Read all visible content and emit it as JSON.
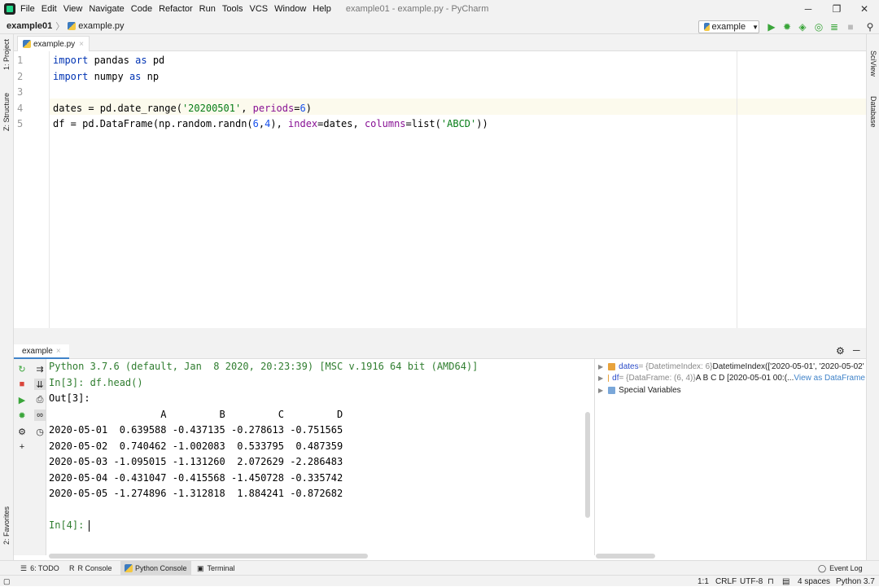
{
  "menubar": {
    "items": [
      "File",
      "Edit",
      "View",
      "Navigate",
      "Code",
      "Refactor",
      "Run",
      "Tools",
      "VCS",
      "Window",
      "Help"
    ],
    "title": "example01 - example.py - PyCharm"
  },
  "window": {
    "minimize": "─",
    "maximize": "❐",
    "close": "✕"
  },
  "navbar": {
    "project": "example01",
    "file": "example.py",
    "separator": "〉"
  },
  "run_config": {
    "name": "example"
  },
  "left_stripe": {
    "project": "1: Project",
    "structure": "Z: Structure",
    "favorites": "2: Favorites"
  },
  "right_stripe": {
    "sciview": "SciView",
    "database": "Database"
  },
  "editor": {
    "tab_label": "example.py",
    "tab_close": "×",
    "lines": [
      "1",
      "2",
      "3",
      "4",
      "5"
    ]
  },
  "code": {
    "l1": {
      "kw1": "import",
      "mid": " pandas ",
      "kw2": "as",
      "end": " pd"
    },
    "l2": {
      "kw1": "import",
      "mid": " numpy ",
      "kw2": "as",
      "end": " np"
    },
    "l4": {
      "a": "dates = pd.date_range(",
      "s": "'20200501'",
      "b": ", ",
      "p": "periods",
      "c": "=",
      "n": "6",
      "d": ")"
    },
    "l5": {
      "a": "df = pd.DataFrame(np.random.randn(",
      "n1": "6",
      "c": ",",
      "n2": "4",
      "b": "), ",
      "p1": "index",
      "e": "=dates, ",
      "p2": "columns",
      "f": "=list(",
      "s": "'ABCD'",
      "g": "))"
    }
  },
  "console": {
    "tab_label": "example",
    "tab_close": "×",
    "lines": [
      "Python 3.7.6 (default, Jan  8 2020, 20:23:39) [MSC v.1916 64 bit (AMD64)]",
      "In[3]: df.head()",
      "Out[3]:",
      "                   A         B         C         D",
      "2020-05-01  0.639588 -0.437135 -0.278613 -0.751565",
      "2020-05-02  0.740462 -1.002083  0.533795  0.487359",
      "2020-05-03 -1.095015 -1.131260  2.072629 -2.286483",
      "2020-05-04 -0.431047 -0.415568 -1.450728 -0.335742",
      "2020-05-05 -1.274896 -1.312818  1.884241 -0.872682",
      "In[4]: "
    ]
  },
  "variables": [
    {
      "name": "dates",
      "type": " = {DatetimeIndex: 6} ",
      "value": "DatetimeIndex(['2020-05-01', '2020-05-02'",
      "link": ""
    },
    {
      "name": "df",
      "type": " = {DataFrame: (6, 4)} ",
      "value": "A B C D [2020-05-01 00:(...",
      "link": "View as DataFrame"
    },
    {
      "name": "Special Variables",
      "type": "",
      "value": "",
      "link": ""
    }
  ],
  "bottom_tabs": [
    "6: TODO",
    "R Console",
    "Python Console",
    "Terminal"
  ],
  "event_log": "Event Log",
  "status": {
    "position": "1:1",
    "line_sep": "CRLF",
    "encoding": "UTF-8",
    "indent": "4 spaces",
    "interpreter": "Python 3.7"
  },
  "colors": {
    "keyword": "#0033b3",
    "string": "#067d17",
    "number": "#1750eb",
    "param": "#871094",
    "console_green": "#2f7d2f",
    "current_line": "#fcfaed"
  }
}
